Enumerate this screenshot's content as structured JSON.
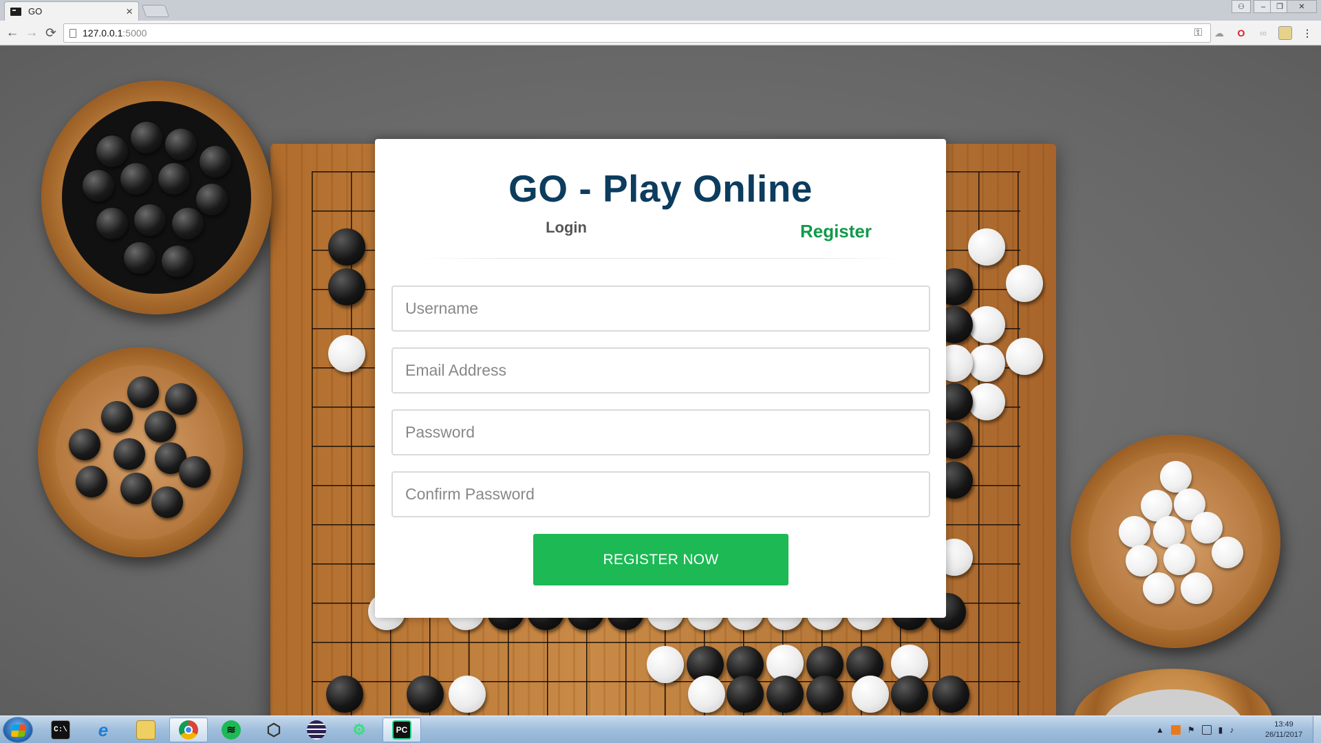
{
  "browser": {
    "tab": {
      "title": "GO",
      "close_label": "×",
      "favicon": "terminal-icon"
    },
    "url_host": "127.0.0.1",
    "url_port": ":5000",
    "nav": {
      "back": "←",
      "forward": "→",
      "reload": "⟳"
    },
    "extensions": [
      "key-icon",
      "cloud-icon",
      "opera-icon",
      "link-icon",
      "image-icon",
      "menu-icon"
    ]
  },
  "card": {
    "title": "GO - Play Online",
    "tabs": {
      "login": "Login",
      "register": "Register"
    },
    "fields": {
      "username": "Username",
      "email": "Email Address",
      "password": "Password",
      "confirm": "Confirm Password"
    },
    "submit": "REGISTER NOW"
  },
  "taskbar": {
    "apps": [
      "Command Prompt",
      "Internet Explorer",
      "File Explorer",
      "Google Chrome",
      "Spotify",
      "Unity",
      "Eclipse",
      "Android Studio",
      "PyCharm"
    ],
    "clock": {
      "time": "13:49",
      "date": "26/11/2017"
    }
  },
  "colors": {
    "title": "#0c3c5e",
    "register_tab": "#109a4a",
    "button": "#1db954"
  }
}
